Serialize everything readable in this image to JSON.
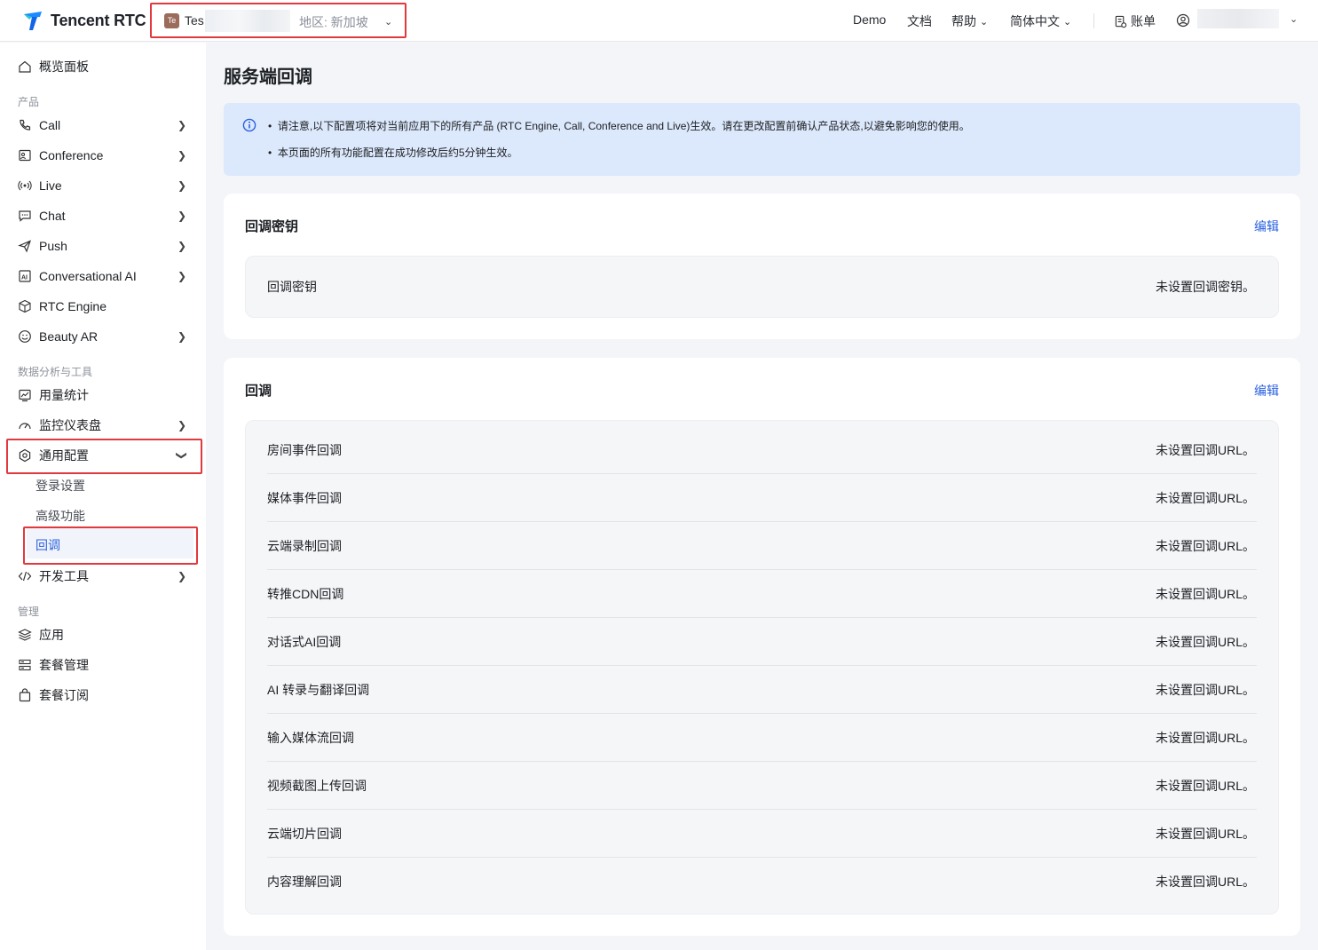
{
  "header": {
    "brand": "Tencent RTC",
    "app": {
      "chip": "Te",
      "name": "Tes",
      "region": "地区: 新加坡"
    },
    "nav": [
      {
        "label": "Demo"
      },
      {
        "label": "文档"
      },
      {
        "label": "帮助"
      },
      {
        "label": "简体中文"
      },
      {
        "label": "账单"
      }
    ]
  },
  "sidebar": {
    "overview": "概览面板",
    "section_products": "产品",
    "products": [
      "Call",
      "Conference",
      "Live",
      "Chat",
      "Push",
      "Conversational AI",
      "RTC Engine",
      "Beauty AR"
    ],
    "section_analytics": "数据分析与工具",
    "usage": "用量统计",
    "monitor": "监控仪表盘",
    "general": "通用配置",
    "general_sub": [
      "登录设置",
      "高级功能",
      "回调"
    ],
    "devtools": "开发工具",
    "section_manage": "管理",
    "manage": [
      "应用",
      "套餐管理",
      "套餐订阅"
    ]
  },
  "main": {
    "title": "服务端回调",
    "notice": [
      "请注意,以下配置项将对当前应用下的所有产品 (RTC Engine, Call, Conference and Live)生效。请在更改配置前确认产品状态,以避免影响您的使用。",
      "本页面的所有功能配置在成功修改后约5分钟生效。"
    ],
    "key_card": {
      "title": "回调密钥",
      "edit": "编辑",
      "row_label": "回调密钥",
      "row_value": "未设置回调密钥。"
    },
    "cb_card": {
      "title": "回调",
      "edit": "编辑",
      "rows": [
        {
          "label": "房间事件回调",
          "value": "未设置回调URL。"
        },
        {
          "label": "媒体事件回调",
          "value": "未设置回调URL。"
        },
        {
          "label": "云端录制回调",
          "value": "未设置回调URL。"
        },
        {
          "label": "转推CDN回调",
          "value": "未设置回调URL。"
        },
        {
          "label": "对话式AI回调",
          "value": "未设置回调URL。"
        },
        {
          "label": "AI 转录与翻译回调",
          "value": "未设置回调URL。"
        },
        {
          "label": "输入媒体流回调",
          "value": "未设置回调URL。"
        },
        {
          "label": "视频截图上传回调",
          "value": "未设置回调URL。"
        },
        {
          "label": "云端切片回调",
          "value": "未设置回调URL。"
        },
        {
          "label": "内容理解回调",
          "value": "未设置回调URL。"
        }
      ]
    }
  }
}
